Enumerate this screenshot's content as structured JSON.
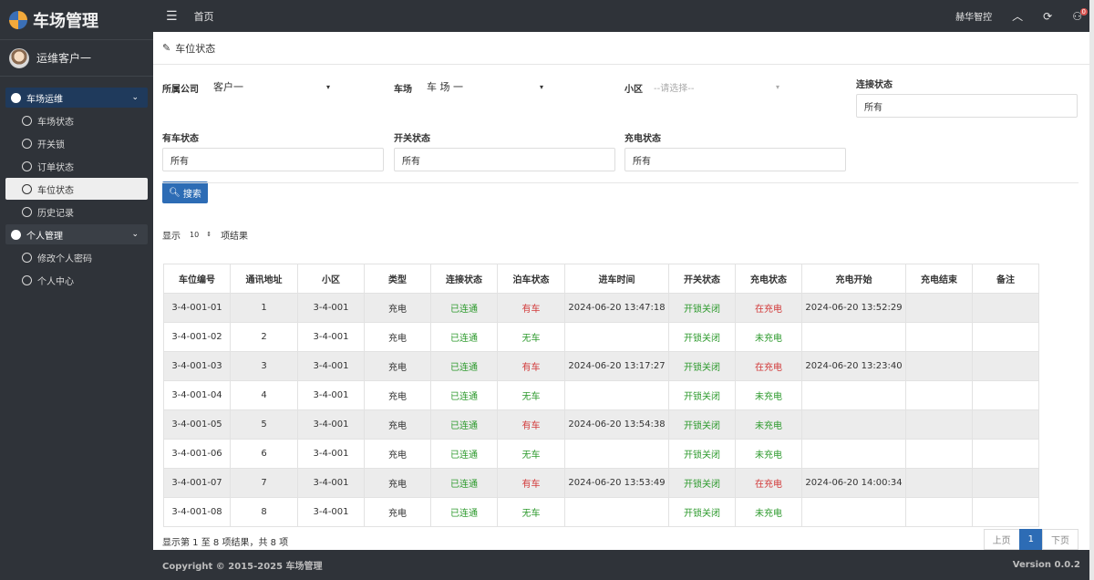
{
  "brand": {
    "title": "车场管理"
  },
  "user": {
    "name": "运维客户一"
  },
  "sidebar": {
    "groups": [
      {
        "label": "车场运维",
        "items": [
          "车场状态",
          "开关锁",
          "订单状态",
          "车位状态",
          "历史记录"
        ]
      },
      {
        "label": "个人管理",
        "items": [
          "修改个人密码",
          "个人中心"
        ]
      }
    ]
  },
  "topbar": {
    "home": "首页",
    "company": "赫华智控",
    "badge": "0"
  },
  "panel": {
    "title": "车位状态"
  },
  "filters": {
    "company_label": "所属公司",
    "company_value": "客户一",
    "lot_label": "车场",
    "lot_value": "车 场 一",
    "area_label": "小区",
    "area_placeholder": "--请选择--",
    "conn_label": "连接状态",
    "conn_value": "所有",
    "car_label": "有车状态",
    "car_value": "所有",
    "switch_label": "开关状态",
    "switch_value": "所有",
    "charge_label": "充电状态",
    "charge_value": "所有",
    "search_label": "搜索"
  },
  "length": {
    "prefix": "显示",
    "value": "10",
    "suffix": "项结果"
  },
  "table": {
    "headers": [
      "车位编号",
      "通讯地址",
      "小区",
      "类型",
      "连接状态",
      "泊车状态",
      "进车时间",
      "开关状态",
      "充电状态",
      "充电开始",
      "充电结束",
      "备注"
    ],
    "rows": [
      [
        "3-4-001-01",
        "1",
        "3-4-001",
        "充电",
        "已连通",
        "有车",
        "2024-06-20 13:47:18",
        "开锁关闭",
        "在充电",
        "2024-06-20 13:52:29",
        "",
        ""
      ],
      [
        "3-4-001-02",
        "2",
        "3-4-001",
        "充电",
        "已连通",
        "无车",
        "",
        "开锁关闭",
        "未充电",
        "",
        "",
        ""
      ],
      [
        "3-4-001-03",
        "3",
        "3-4-001",
        "充电",
        "已连通",
        "有车",
        "2024-06-20 13:17:27",
        "开锁关闭",
        "在充电",
        "2024-06-20 13:23:40",
        "",
        ""
      ],
      [
        "3-4-001-04",
        "4",
        "3-4-001",
        "充电",
        "已连通",
        "无车",
        "",
        "开锁关闭",
        "未充电",
        "",
        "",
        ""
      ],
      [
        "3-4-001-05",
        "5",
        "3-4-001",
        "充电",
        "已连通",
        "有车",
        "2024-06-20 13:54:38",
        "开锁关闭",
        "未充电",
        "",
        "",
        ""
      ],
      [
        "3-4-001-06",
        "6",
        "3-4-001",
        "充电",
        "已连通",
        "无车",
        "",
        "开锁关闭",
        "未充电",
        "",
        "",
        ""
      ],
      [
        "3-4-001-07",
        "7",
        "3-4-001",
        "充电",
        "已连通",
        "有车",
        "2024-06-20 13:53:49",
        "开锁关闭",
        "在充电",
        "2024-06-20 14:00:34",
        "",
        ""
      ],
      [
        "3-4-001-08",
        "8",
        "3-4-001",
        "充电",
        "已连通",
        "无车",
        "",
        "开锁关闭",
        "未充电",
        "",
        "",
        ""
      ]
    ]
  },
  "info": "显示第 1 至 8 项结果，共 8 项",
  "pager": {
    "prev": "上页",
    "current": "1",
    "next": "下页"
  },
  "footer": {
    "copyright": "Copyright © 2015-2025 车场管理",
    "version": "Version 0.0.2"
  },
  "colors": {
    "accent": "#2d6cb5",
    "green": "#2d9a2d",
    "red": "#d23a3a",
    "sidebar": "#2f3339"
  }
}
